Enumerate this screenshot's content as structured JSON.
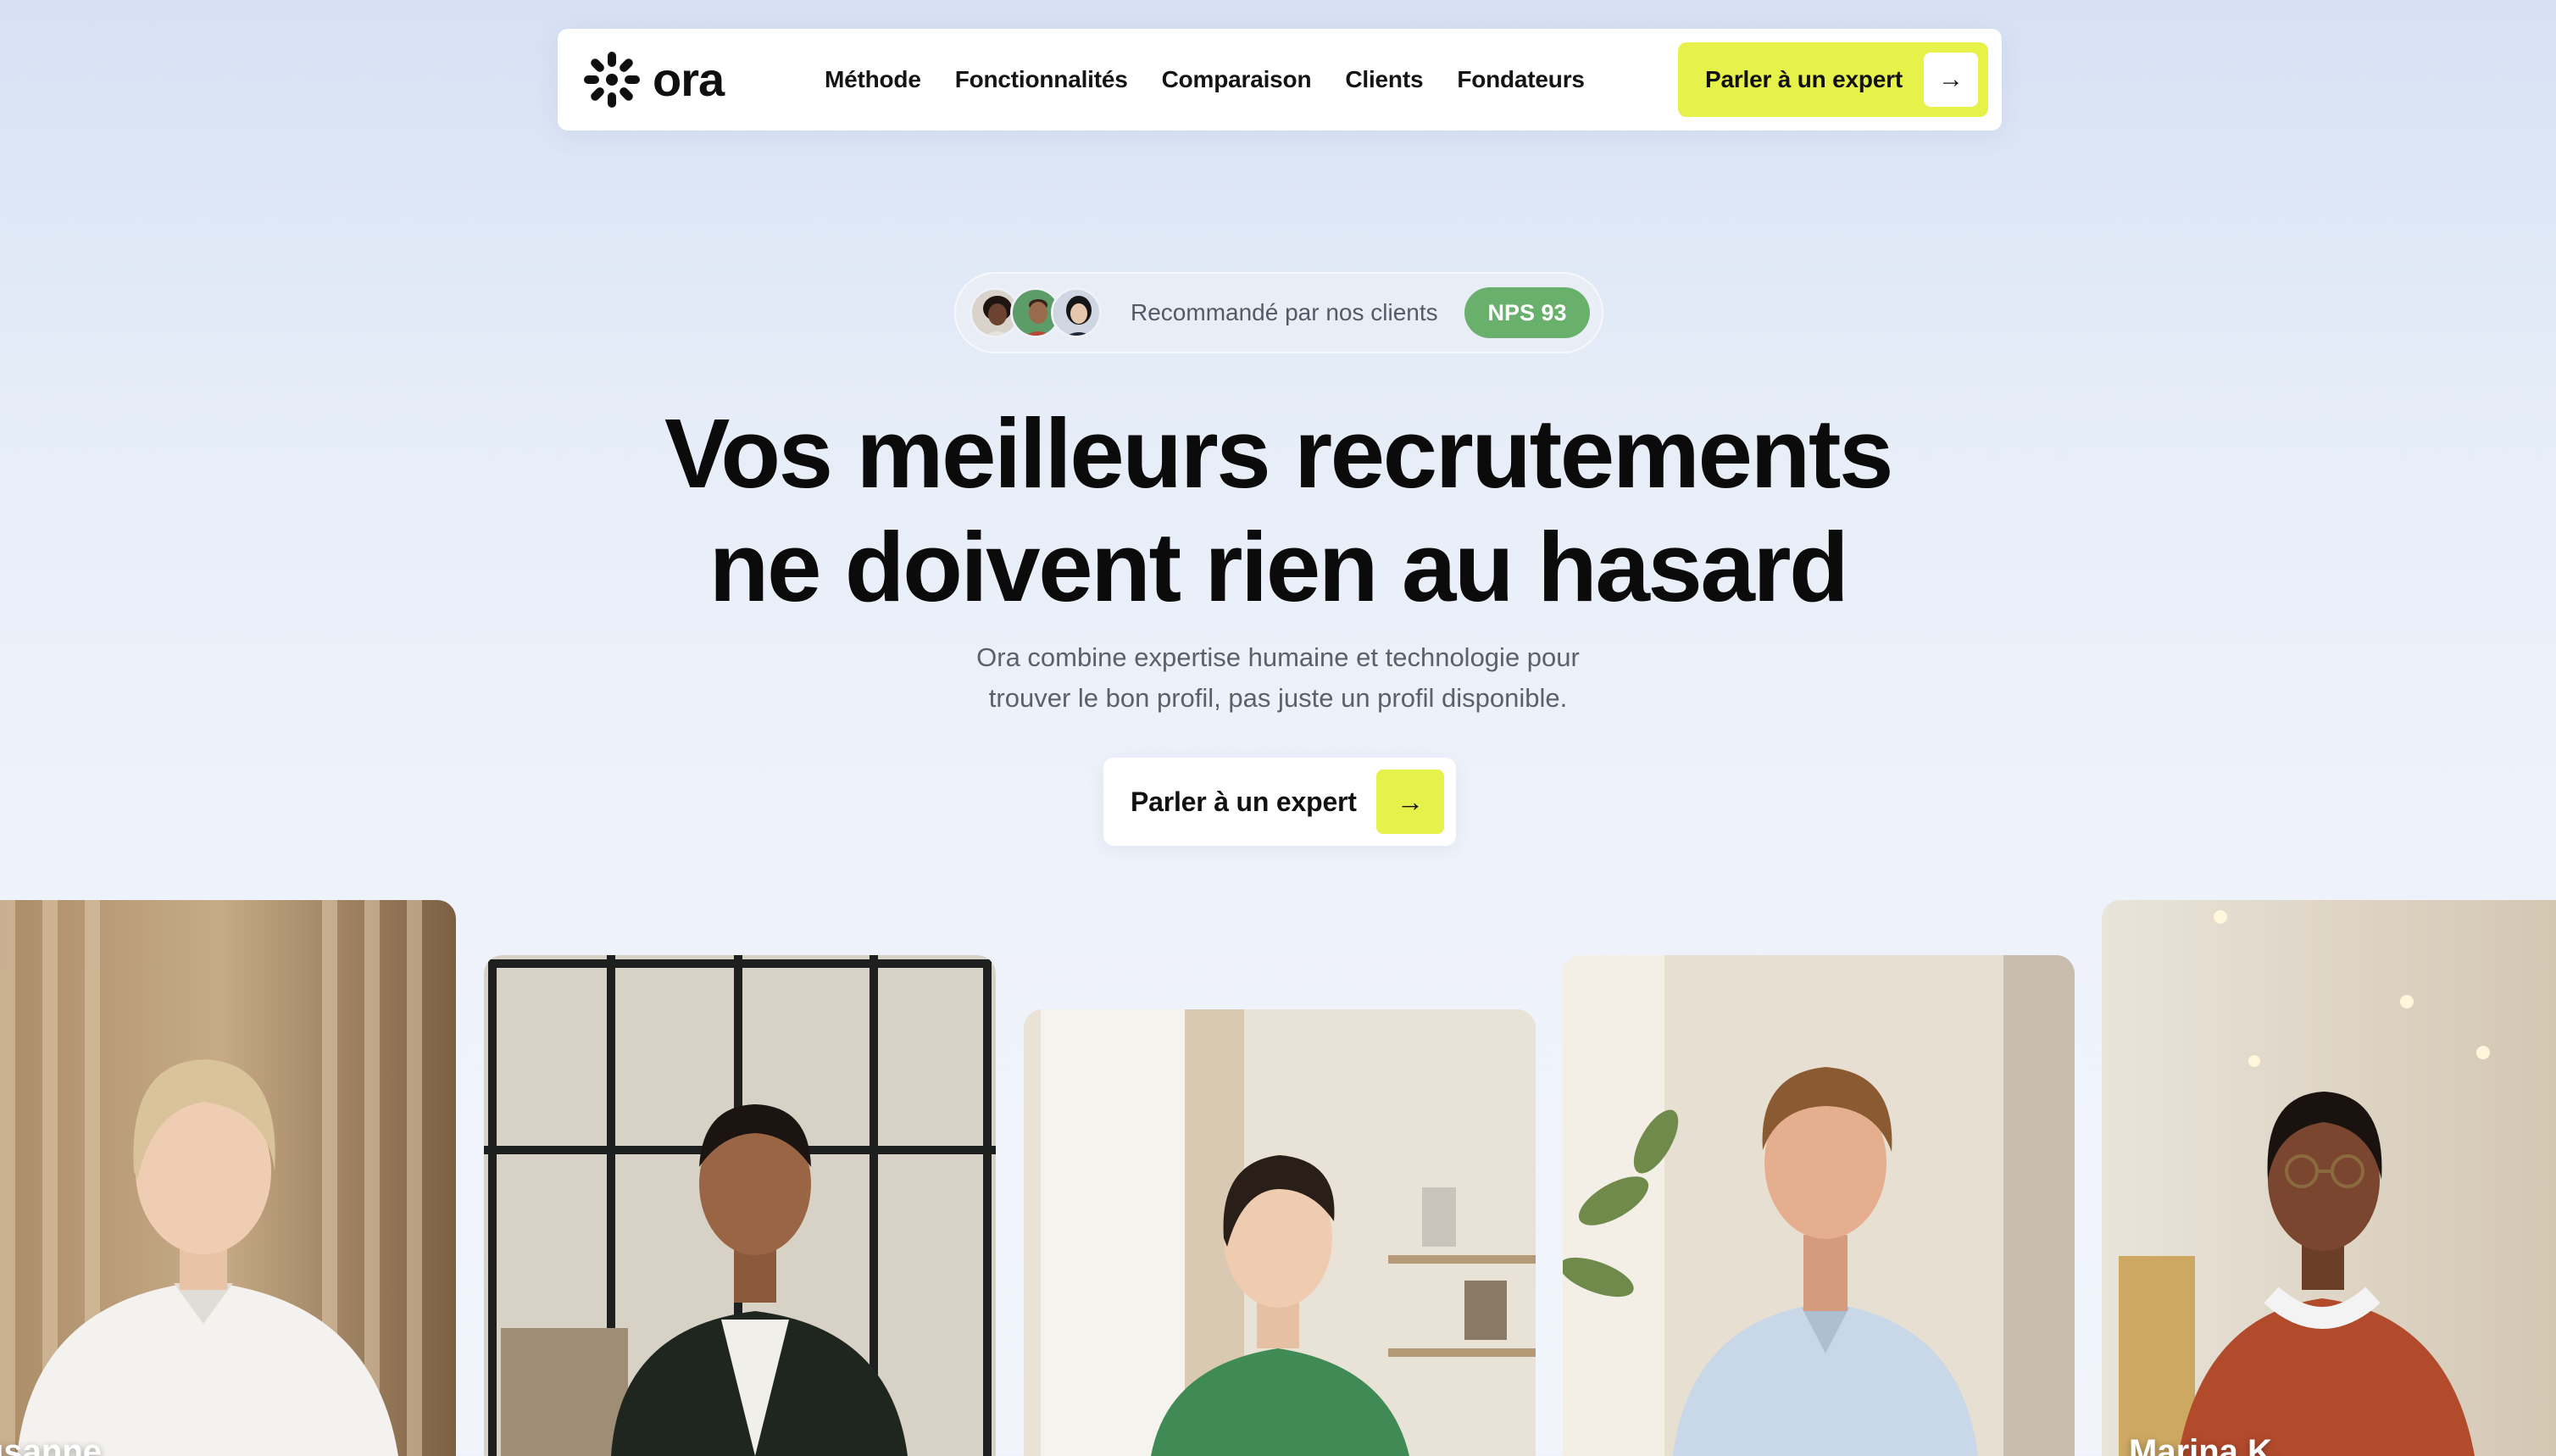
{
  "brand": {
    "name": "ora",
    "logo_icon": "asterisk-logo-icon"
  },
  "nav": {
    "links": [
      "Méthode",
      "Fonctionnalités",
      "Comparaison",
      "Clients",
      "Fondateurs"
    ],
    "cta_label": "Parler à un expert",
    "cta_icon": "arrow-right-icon"
  },
  "badge": {
    "text": "Recommandé par nos clients",
    "nps": "NPS 93",
    "nps_color": "#69b06c"
  },
  "hero": {
    "title_line1": "Vos meilleurs recrutements",
    "title_line2": "ne doivent rien au hasard",
    "subtitle_line1": "Ora combine expertise humaine et technologie pour",
    "subtitle_line2": "trouver le bon profil, pas juste un profil disponible.",
    "cta_label": "Parler à un expert",
    "cta_icon": "arrow-right-icon"
  },
  "cards": [
    {
      "name": "usanne"
    },
    {
      "name": ""
    },
    {
      "name": ""
    },
    {
      "name": ""
    },
    {
      "name": "Marina K."
    }
  ],
  "colors": {
    "accent": "#e6f14a",
    "text": "#0b0b0b",
    "muted": "#5b606a"
  }
}
